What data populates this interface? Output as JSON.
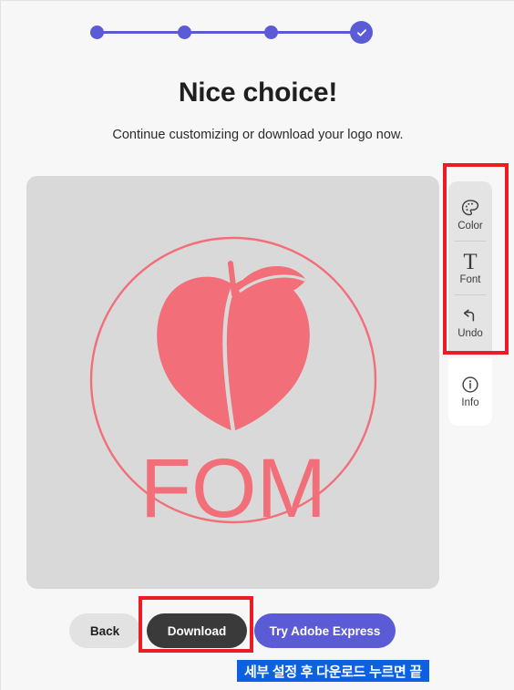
{
  "page": {
    "background_color": "#f7f7f7",
    "accent_color": "#5b5bd6",
    "annotation_red": "#ec1c24",
    "annotation_blue": "#0b61e0"
  },
  "stepper": {
    "steps": [
      {
        "name": "step-1",
        "state": "complete"
      },
      {
        "name": "step-2",
        "state": "complete"
      },
      {
        "name": "step-3",
        "state": "complete"
      },
      {
        "name": "step-4",
        "state": "current-check"
      }
    ],
    "check_icon": "check-icon"
  },
  "heading": {
    "title": "Nice choice!",
    "subtitle": "Continue customizing or download your logo now."
  },
  "canvas": {
    "background_color": "#d9d9d9",
    "logo": {
      "brand_text": "FOM",
      "color": "#f26e78",
      "shape": "peach-with-leaf-in-circle",
      "circle_outline": true
    }
  },
  "toolbar": {
    "items": [
      {
        "label": "Color",
        "icon": "palette-icon"
      },
      {
        "label": "Font",
        "icon": "text-format-icon"
      },
      {
        "label": "Undo",
        "icon": "undo-arrow-icon"
      }
    ],
    "info": {
      "label": "Info",
      "icon": "info-circle-icon"
    }
  },
  "actions": {
    "back_label": "Back",
    "download_label": "Download",
    "express_label": "Try Adobe Express"
  },
  "annotations": {
    "caption": "세부 설정 후 다운로드 누르면 끝",
    "highlight_toolbar": "toolbar-highlight",
    "highlight_download": "download-highlight"
  }
}
